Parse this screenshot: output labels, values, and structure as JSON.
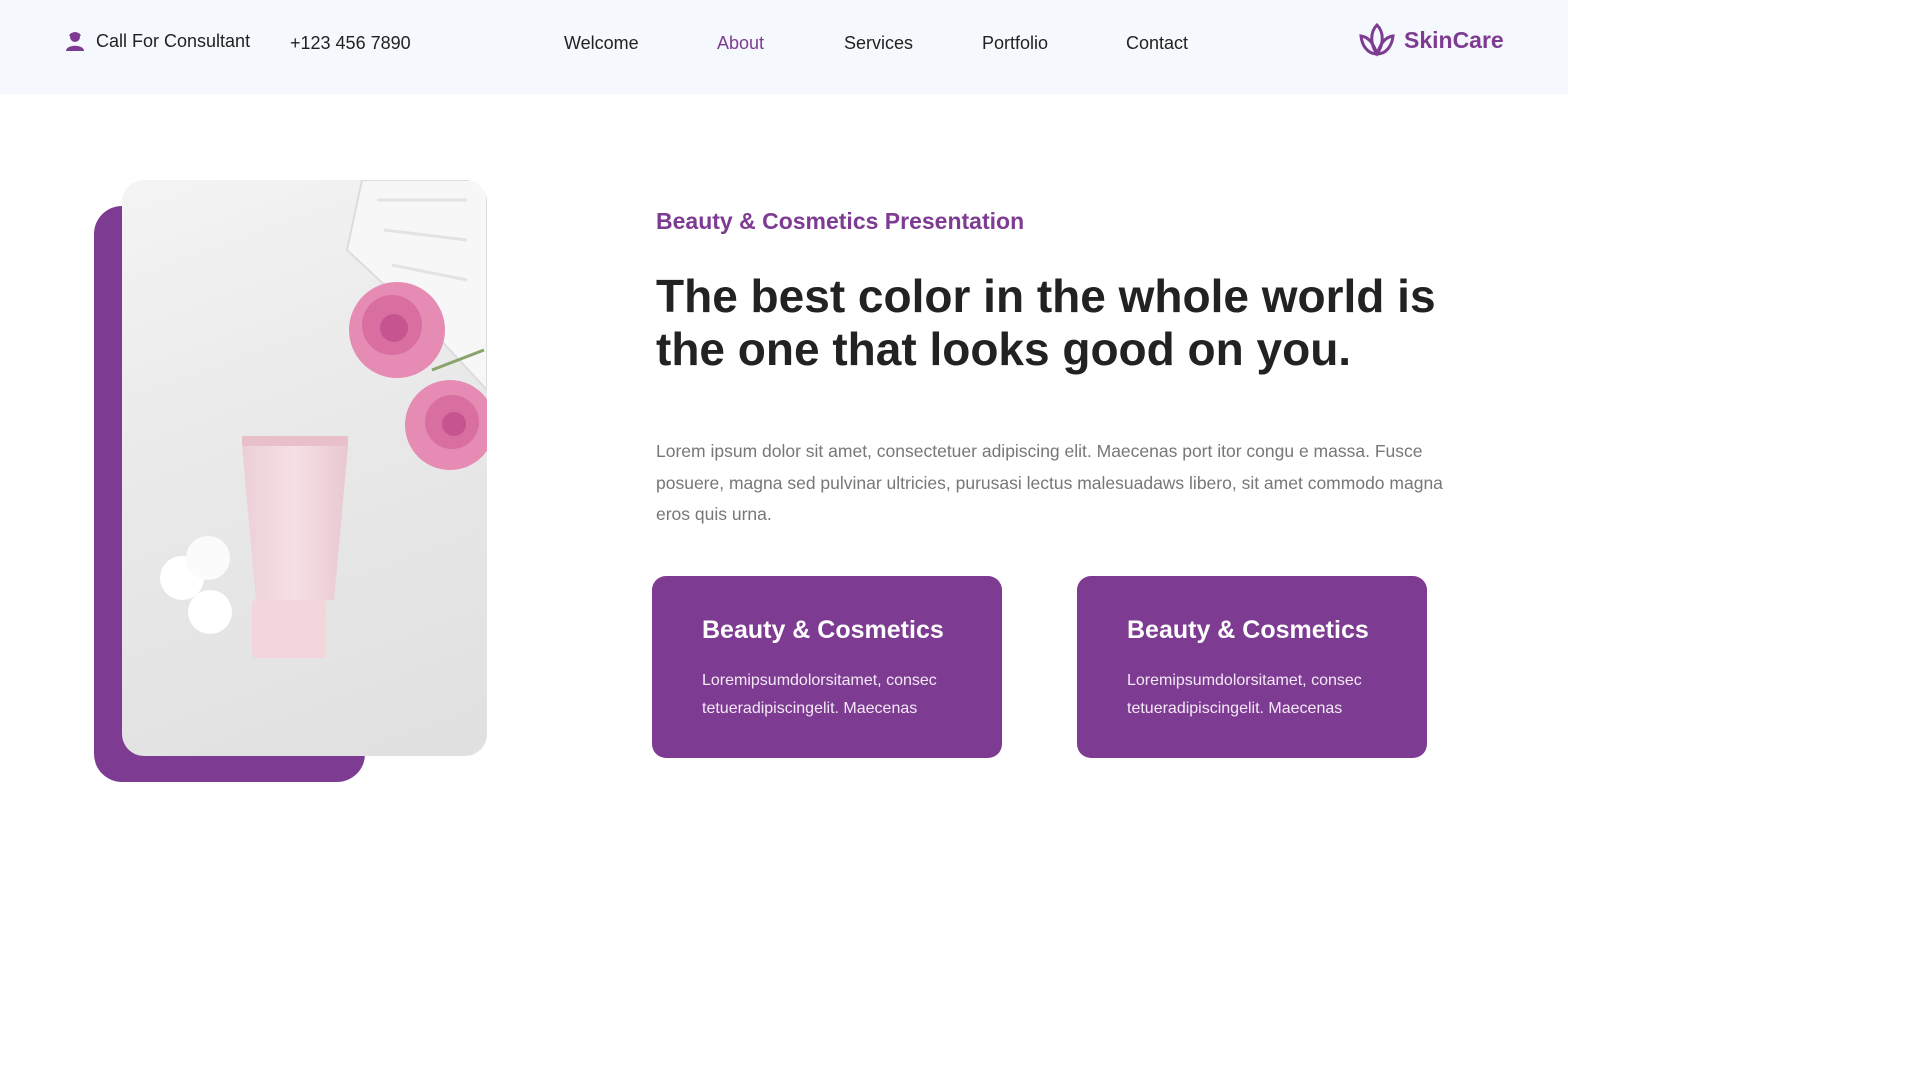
{
  "header": {
    "consult_label": "Call For Consultant",
    "phone": "+123 456 7890",
    "nav": [
      {
        "label": "Welcome",
        "active": false
      },
      {
        "label": "About",
        "active": true
      },
      {
        "label": "Services",
        "active": false
      },
      {
        "label": "Portfolio",
        "active": false
      },
      {
        "label": "Contact",
        "active": false
      }
    ],
    "brand": "SkinCare",
    "icons": {
      "consult": "person-icon",
      "brand": "lotus-icon"
    }
  },
  "main": {
    "subtitle": "Beauty & Cosmetics Presentation",
    "headline": "The best color in the whole world is the one that looks good on you.",
    "body": "Lorem ipsum dolor sit amet, consectetuer adipiscing elit. Maecenas port itor congu e massa. Fusce posuere, magna sed pulvinar ultricies, purusasi lectus malesuadaws libero, sit amet commodo magna eros quis urna.",
    "cards": [
      {
        "title": "Beauty & Cosmetics",
        "text": "Loremipsumdolorsitamet, consec tetueradipiscingelit. Maecenas"
      },
      {
        "title": "Beauty & Cosmetics",
        "text": "Loremipsumdolorsitamet, consec tetueradipiscingelit. Maecenas"
      }
    ]
  },
  "colors": {
    "accent": "#7e3b92",
    "header_bg": "#f5f8fc",
    "text_dark": "#222222",
    "text_muted": "#777777"
  }
}
